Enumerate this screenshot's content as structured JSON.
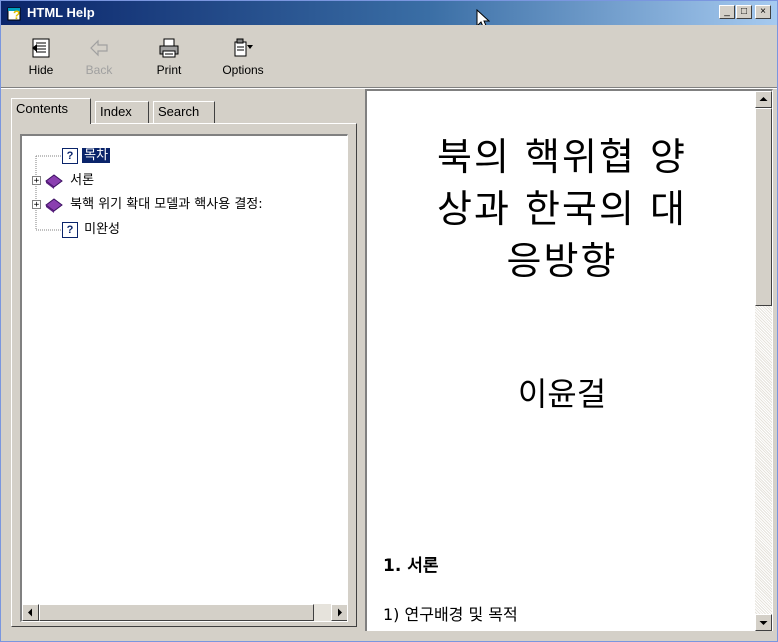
{
  "window": {
    "title": "HTML Help",
    "minimize_glyph": "_",
    "maximize_glyph": "□",
    "close_glyph": "×"
  },
  "toolbar": {
    "buttons": [
      {
        "label": "Hide",
        "icon": "hide-icon",
        "enabled": true
      },
      {
        "label": "Back",
        "icon": "back-arrow-icon",
        "enabled": false
      },
      {
        "label": "Print",
        "icon": "printer-icon",
        "enabled": true
      },
      {
        "label": "Options",
        "icon": "options-icon",
        "enabled": true
      }
    ]
  },
  "tabs": [
    {
      "label": "Contents",
      "active": true
    },
    {
      "label": "Index",
      "active": false
    },
    {
      "label": "Search",
      "active": false
    }
  ],
  "tree": {
    "items": [
      {
        "label": "목차",
        "icon": "question-page-icon",
        "expandable": false,
        "selected": true
      },
      {
        "label": "서론",
        "icon": "book-icon",
        "expandable": true,
        "selected": false
      },
      {
        "label": "북핵 위기 확대 모델과 핵사용 결정:",
        "icon": "book-icon",
        "expandable": true,
        "selected": false
      },
      {
        "label": "미완성",
        "icon": "question-page-icon",
        "expandable": false,
        "selected": false
      }
    ]
  },
  "document": {
    "title_lines": [
      "북의 핵위협 양",
      "상과 한국의 대",
      "응방향"
    ],
    "author": "이윤걸",
    "section_heading": "1. 서론",
    "subsection_heading": "1) 연구배경 및 목적"
  },
  "colors": {
    "titlebar_start": "#0a246a",
    "titlebar_end": "#a6caf0",
    "selection": "#0a246a",
    "face": "#d4d0c8"
  }
}
